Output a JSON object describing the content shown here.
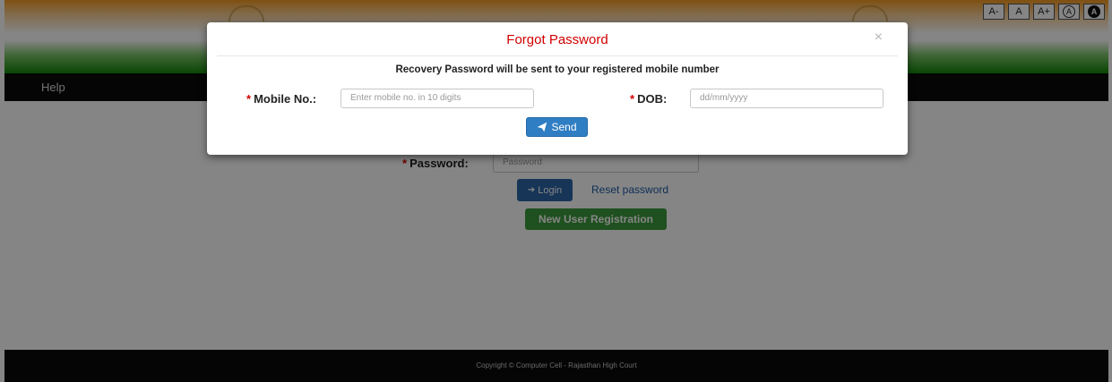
{
  "accessibility": {
    "buttons": [
      {
        "label": "A-"
      },
      {
        "label": "A"
      },
      {
        "label": "A+"
      },
      {
        "label": "A"
      },
      {
        "label": "A"
      }
    ]
  },
  "navbar": {
    "help_label": "Help"
  },
  "login": {
    "password_label": "Password:",
    "password_placeholder": "Password",
    "login_label": "Login",
    "reset_link": "Reset password",
    "register_label": "New User Registration",
    "required_mark": "*"
  },
  "footer": {
    "text": "Copyright © Computer Cell - Rajasthan High Court"
  },
  "modal": {
    "title": "Forgot Password",
    "close": "×",
    "info": "Recovery Password will be sent to your registered mobile number",
    "mobile_label": "Mobile No.:",
    "mobile_placeholder": "Enter mobile no. in 10 digits",
    "dob_label": "DOB:",
    "dob_placeholder": "dd/mm/yyyy",
    "send_label": "Send",
    "required_mark": "*"
  },
  "colors": {
    "header_saffron": "#f39a21",
    "header_green": "#138808",
    "required": "#d60000",
    "modal_title": "#d00000",
    "primary": "#2f7ec3",
    "success": "#3c9a3c"
  }
}
